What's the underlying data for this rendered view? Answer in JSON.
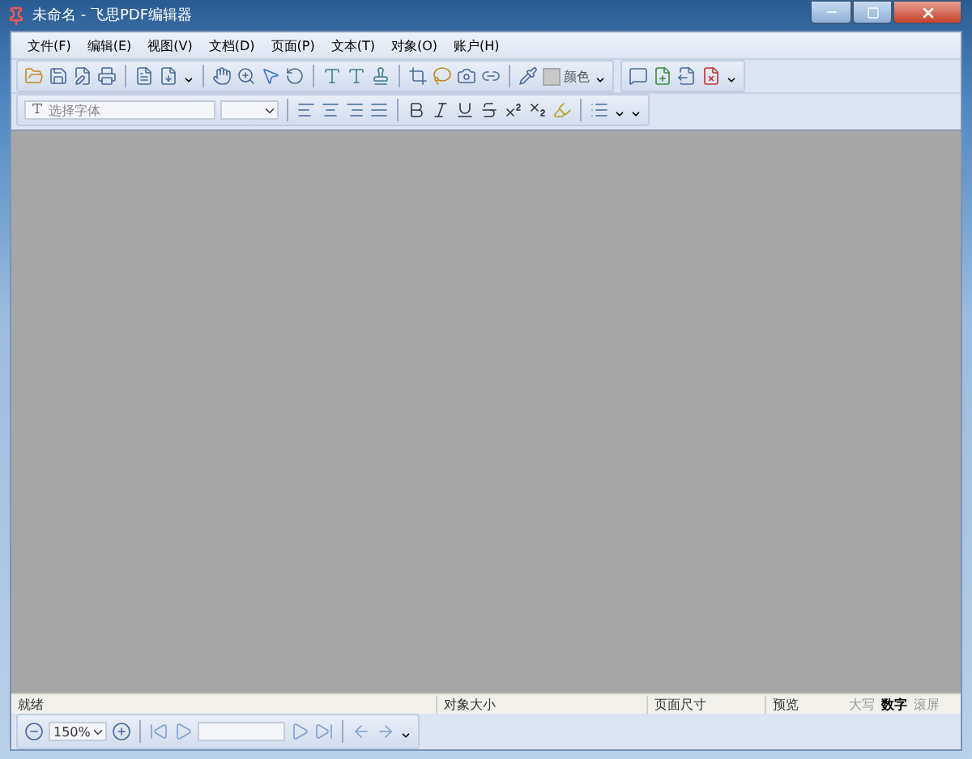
{
  "window": {
    "title": "未命名 - 飞思PDF编辑器"
  },
  "menu": [
    {
      "label": "文件(F)"
    },
    {
      "label": "编辑(E)"
    },
    {
      "label": "视图(V)"
    },
    {
      "label": "文档(D)"
    },
    {
      "label": "页面(P)"
    },
    {
      "label": "文本(T)"
    },
    {
      "label": "对象(O)"
    },
    {
      "label": "账户(H)"
    }
  ],
  "toolbar": {
    "color_label": "颜色"
  },
  "format_bar": {
    "font_field": {
      "placeholder": "选择字体"
    }
  },
  "status_bar": {
    "message": "就绪",
    "object_size": "对象大小",
    "page_size": "页面尺寸",
    "preview": "预览",
    "indicators": [
      {
        "label": "大写",
        "on": false
      },
      {
        "label": "数字",
        "on": true
      },
      {
        "label": "滚屏",
        "on": false
      }
    ]
  },
  "navigation": {
    "zoom": "150%"
  }
}
